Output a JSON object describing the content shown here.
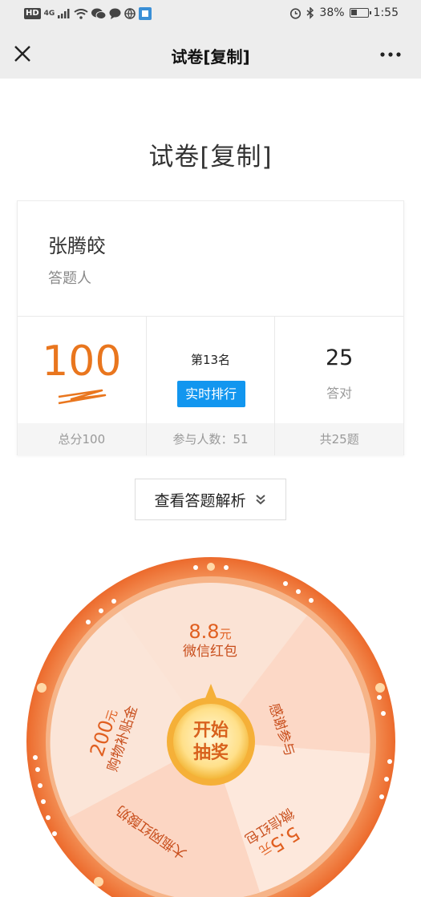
{
  "status_bar": {
    "hd": "HD",
    "network": "4G",
    "battery": "38%",
    "time": "1:55",
    "battery_level": 0.38
  },
  "nav": {
    "title": "试卷[复制]"
  },
  "page": {
    "title": "试卷[复制]"
  },
  "result": {
    "name": "张腾皎",
    "role": "答题人",
    "score": "100",
    "total_score": "总分100",
    "rank": "第13名",
    "rank_button": "实时排行",
    "participants": "参与人数：51",
    "correct_count": "25",
    "correct_label": "答对",
    "total_questions": "共25题"
  },
  "analysis_button": {
    "label": "查看答题解析"
  },
  "lottery": {
    "start_line1": "开始",
    "start_line2": "抽奖",
    "prizes": [
      {
        "amount": "8.8",
        "unit": "元",
        "desc": "微信红包"
      },
      {
        "amount": "",
        "unit": "",
        "desc": "感谢参与"
      },
      {
        "amount": "5.5",
        "unit": "元",
        "desc": "微信红包"
      },
      {
        "amount": "",
        "unit": "",
        "desc": "大瓶网红酸奶"
      },
      {
        "amount": "200",
        "unit": "元",
        "desc": "购物补贴金"
      }
    ]
  },
  "colors": {
    "accent_orange": "#e9761e",
    "button_blue": "#1296ef",
    "wheel_rim": "#ef7a3a"
  }
}
